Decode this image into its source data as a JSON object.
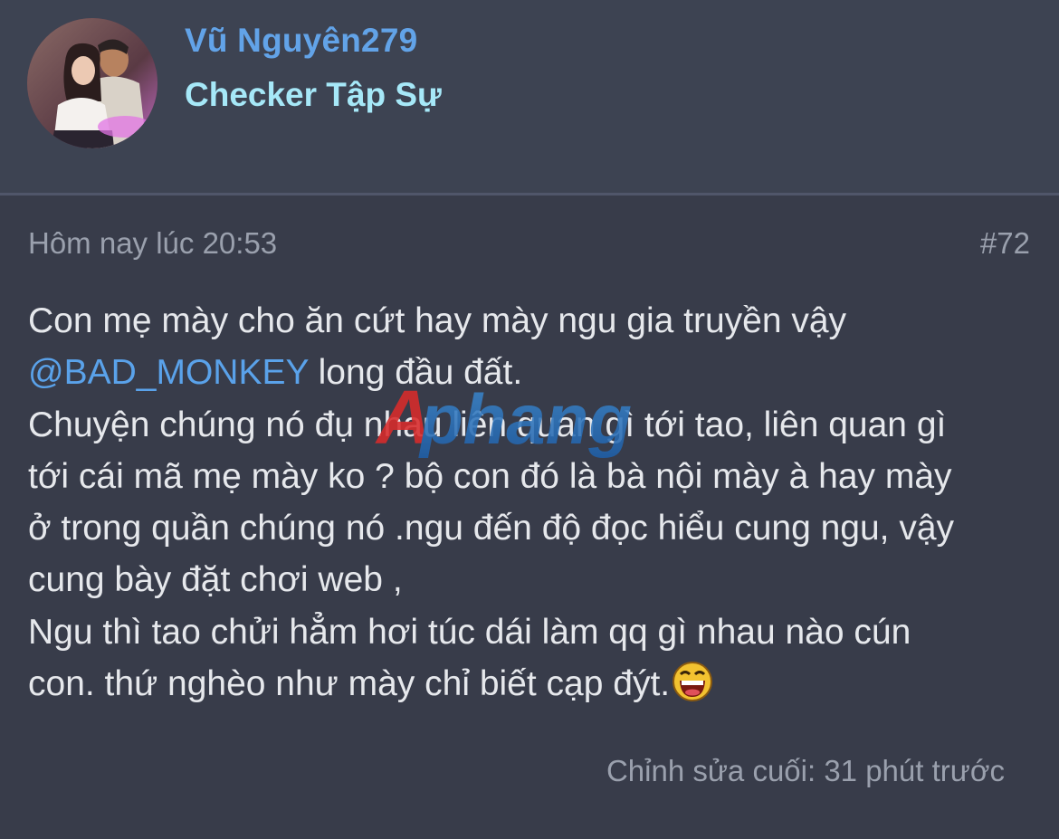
{
  "user": {
    "name": "Vũ Nguyên279",
    "title": "Checker Tập Sự"
  },
  "post": {
    "time": "Hôm nay lúc 20:53",
    "number": "#72",
    "lines": {
      "l1": "Con mẹ mày cho ăn cứt hay mày ngu gia truyền vậy",
      "l2_mention": "@BAD_MONKEY",
      "l2_rest": " long đầu đất.",
      "l3": "Chuyện chúng nó đụ nhau liên quan gì tới tao, liên quan gì",
      "l4": "tới cái mã mẹ mày ko ? bộ con đó là bà nội mày à hay mày",
      "l5": "ở trong quần chúng nó .ngu đến độ đọc hiểu cung ngu, vậy",
      "l6": "cung bày đặt chơi web ,",
      "l7": "Ngu thì tao chửi hẳm hơi túc dái làm qq gì nhau nào cún",
      "l8": "con. thứ nghèo như mày chỉ biết cạp đýt."
    },
    "emoji": "laughing-face-icon",
    "last_edit": "Chỉnh sửa cuối: 31 phút trước"
  },
  "watermark": {
    "text_a": "A",
    "text_b": "phang"
  },
  "colors": {
    "background": "#383c4a",
    "header_bg": "#3d4352",
    "username": "#62a3e8",
    "user_title": "#a6e8f8",
    "mention": "#5aa2ea",
    "meta_text": "#9aa0ad",
    "body_text": "#e6e8ec"
  }
}
